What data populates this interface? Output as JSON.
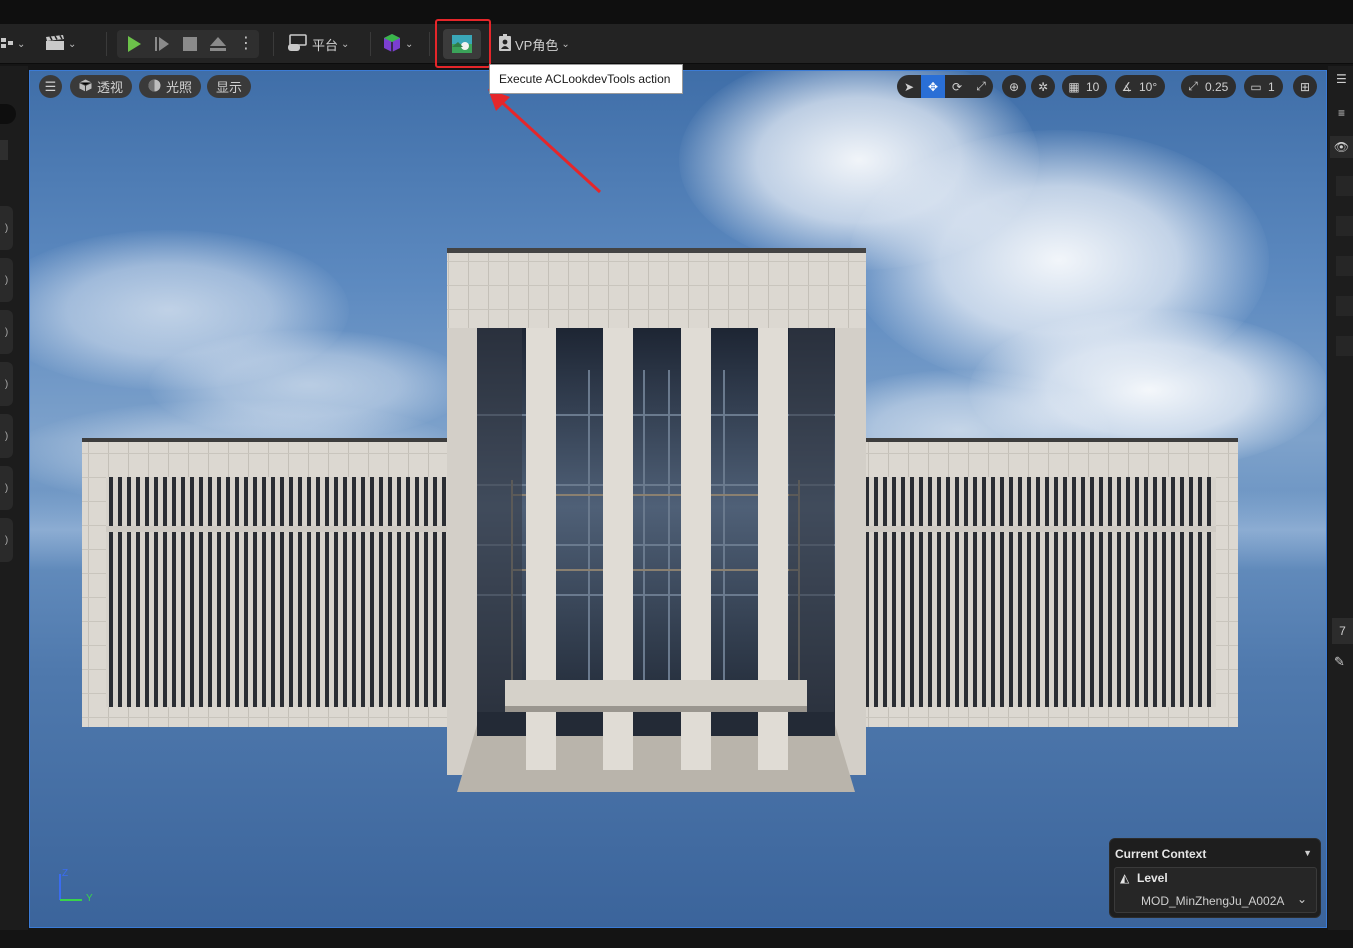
{
  "toolbar": {
    "platform_label": "平台",
    "vp_role_label": "VP角色"
  },
  "tooltip": {
    "text": "Execute ACLookdevTools action"
  },
  "viewport_toolbar": {
    "perspective_label": "透视",
    "lighting_label": "光照",
    "show_label": "显示",
    "grid_snap_value": "10",
    "rotation_snap_value": "10°",
    "scale_snap_value": "0.25",
    "camera_speed_value": "1"
  },
  "right_panel": {
    "partial_value": "7"
  },
  "current_context": {
    "title": "Current Context",
    "level_label": "Level",
    "map_name": "MOD_MinZhengJu_A002A"
  },
  "axis": {
    "z_label": "Z",
    "y_label": "Y"
  },
  "colors": {
    "highlight_box": "#e5262a",
    "active_tool": "#2a6fd6",
    "play_green": "#6cc24a"
  }
}
